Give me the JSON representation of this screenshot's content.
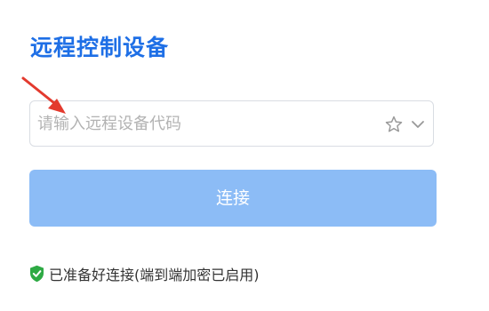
{
  "title": "远程控制设备",
  "device_input": {
    "value": "",
    "placeholder": "请输入远程设备代码"
  },
  "icons": {
    "favorite": "star-icon",
    "dropdown": "chevron-down-icon",
    "status": "shield-check-icon",
    "annotation": "red-arrow-icon"
  },
  "connect_button": {
    "label": "连接"
  },
  "status": {
    "text": "已准备好连接(端到端加密已启用)"
  },
  "colors": {
    "title": "#1e6fe6",
    "button_bg": "#8cbcf6",
    "shield": "#2eaa44",
    "arrow": "#e33a2e"
  }
}
